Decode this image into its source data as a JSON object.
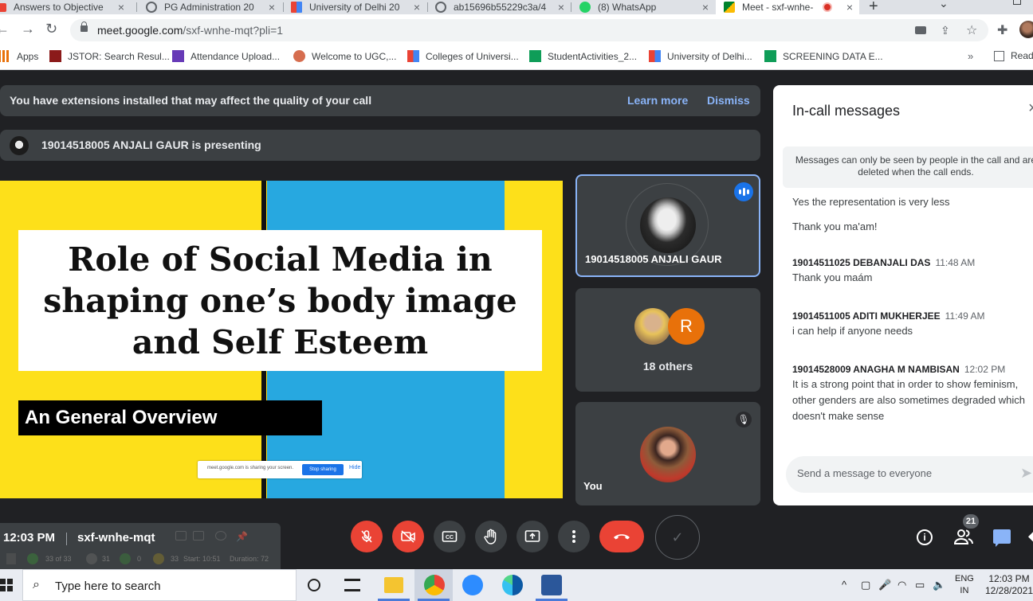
{
  "browser": {
    "tabs": [
      {
        "label": "Answers to Objective",
        "favicon_color": "#ea4335"
      },
      {
        "label": "PG Administration 20",
        "favicon_color": "#5f6368"
      },
      {
        "label": "University of Delhi 20",
        "favicon_color": "#f4b400"
      },
      {
        "label": "ab15696b55229c3a/4",
        "favicon_color": "#5f6368"
      },
      {
        "label": "(8) WhatsApp",
        "favicon_color": "#25d366"
      },
      {
        "label": "Meet - sxf-wnhe-",
        "favicon_color": "#00832d",
        "active": true
      }
    ],
    "new_tab": "+",
    "url_host": "meet.google.com",
    "url_path": "/sxf-wnhe-mqt?pli=1",
    "bookmarks": [
      {
        "label": "Apps",
        "color": "#e8710a"
      },
      {
        "label": "JSTOR: Search Resul...",
        "color": "#8b1a1a"
      },
      {
        "label": "Attendance Upload...",
        "color": "#673ab7"
      },
      {
        "label": "Welcome to UGC,...",
        "color": "#d66d4f"
      },
      {
        "label": "Colleges of Universi...",
        "color": "#4285f4"
      },
      {
        "label": "StudentActivities_2...",
        "color": "#0f9d58"
      },
      {
        "label": "University of Delhi...",
        "color": "#4285f4"
      },
      {
        "label": "SCREENING DATA E...",
        "color": "#0f9d58"
      }
    ],
    "bookmarks_more": "»",
    "reading_list": "Read"
  },
  "meet": {
    "extension_banner": {
      "message": "You have extensions installed that may affect the quality of your call",
      "learn_more": "Learn more",
      "dismiss": "Dismiss"
    },
    "presenting_banner": "19014518005 ANJALI GAUR is presenting",
    "slide": {
      "title": "Role of Social Media in shaping one’s body image and Self Esteem",
      "subtitle": "An General Overview",
      "share_notice": "meet.google.com is sharing your screen.",
      "stop_sharing": "Stop sharing",
      "hide": "Hide"
    },
    "tiles": {
      "presenter_name": "19014518005 ANJALI GAUR",
      "others_label": "18 others",
      "others_initial": "R",
      "you_label": "You"
    },
    "chat": {
      "title": "In-call messages",
      "close": "×",
      "notice": "Messages can only be seen by people in the call and are deleted when the call ends.",
      "messages": [
        {
          "sender": "",
          "time": "",
          "text": "Yes the representation is very less"
        },
        {
          "sender": "",
          "time": "",
          "text": "Thank you ma'am!"
        },
        {
          "sender": "19014511025 DEBANJALI DAS",
          "time": "11:48 AM",
          "text": "Thank you maám"
        },
        {
          "sender": "19014511005 ADITI MUKHERJEE",
          "time": "11:49 AM",
          "text": "i can help if anyone needs"
        },
        {
          "sender": "19014528009 ANAGHA M NAMBISAN",
          "time": "12:02 PM",
          "text": "It is a strong point that in order to show feminism, other genders are also sometimes degraded which doesn't make sense"
        }
      ],
      "input_placeholder": "Send a message to everyone"
    },
    "controls": {
      "clock": "12:03 PM",
      "meeting_code": "sxf-wnhe-mqt",
      "participant_count": "21",
      "extension_strip": {
        "count1": "33 of 33",
        "count2": "31",
        "count3": "0",
        "count4": "33",
        "start": "Start: 10:51",
        "duration": "Duration: 72"
      }
    }
  },
  "taskbar": {
    "search_placeholder": "Type here to search",
    "lang_line1": "ENG",
    "lang_line2": "IN",
    "time": "12:03 PM",
    "date": "12/28/2021"
  }
}
